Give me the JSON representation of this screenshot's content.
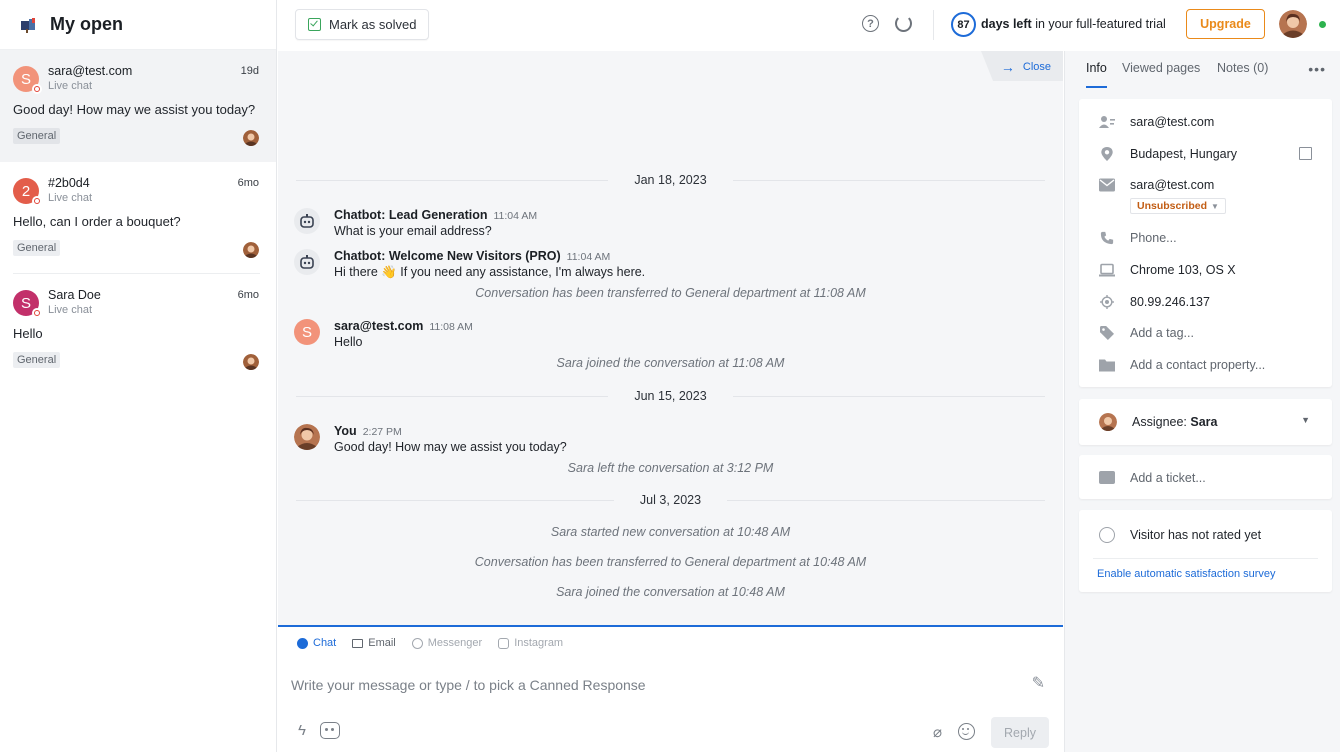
{
  "sidebar": {
    "title": "My open",
    "conversations": [
      {
        "name": "sara@test.com",
        "channel": "Live chat",
        "time": "19d",
        "message": "Good day! How may we assist you today?",
        "tag": "General",
        "avatar_letter": "S",
        "avatar_color": "#f2937a"
      },
      {
        "name": "#2b0d4",
        "channel": "Live chat",
        "time": "6mo",
        "message": "Hello, can I order a bouquet?",
        "tag": "General",
        "avatar_letter": "2",
        "avatar_color": "#e35d4a"
      },
      {
        "name": "Sara Doe",
        "channel": "Live chat",
        "time": "6mo",
        "message": "Hello",
        "tag": "General",
        "avatar_letter": "S",
        "avatar_color": "#c2306a"
      }
    ]
  },
  "toolbar": {
    "mark_solved_label": "Mark as solved",
    "help_glyph": "?",
    "trial_days": "87",
    "trial_bold": "days left",
    "trial_rest": " in your full-featured trial",
    "upgrade_label": "Upgrade"
  },
  "conversation": {
    "close_label": "Close",
    "close_glyph": "→",
    "dates": [
      "Jan 18, 2023",
      "Jun 15, 2023",
      "Jul 3, 2023"
    ],
    "messages": [
      {
        "sender": "Chatbot: Lead Generation",
        "time": "11:04 AM",
        "text": "What is your email address?"
      },
      {
        "sender": "Chatbot: Welcome New Visitors (PRO)",
        "time": "11:04 AM",
        "text": "Hi there 👋 If you need any assistance, I'm always here."
      },
      {
        "sender": "sara@test.com",
        "time": "11:08 AM",
        "text": "Hello",
        "avatar_letter": "S"
      },
      {
        "sender": "You",
        "time": "2:27 PM",
        "text": "Good day! How may we assist you today?"
      }
    ],
    "system": [
      "Conversation has been transferred to General department at 11:08 AM",
      "Sara joined the conversation at 11:08 AM",
      "Sara left the conversation at 3:12 PM",
      "Sara started new conversation at 10:48 AM",
      "Conversation has been transferred to General department at 10:48 AM",
      "Sara joined the conversation at 10:48 AM"
    ]
  },
  "composer": {
    "channels": [
      "Chat",
      "Email",
      "Messenger",
      "Instagram"
    ],
    "placeholder": "Write your message or type / to pick a Canned Response",
    "reply_label": "Reply",
    "magic_glyph": "✎",
    "bolt_glyph": "ϟ",
    "clip_glyph": "⌀"
  },
  "panel": {
    "tabs": [
      "Info",
      "Viewed pages",
      "Notes (0)"
    ],
    "more_glyph": "•••",
    "info": {
      "contact": "sara@test.com",
      "location": "Budapest, Hungary",
      "email": "sara@test.com",
      "subscription": "Unsubscribed",
      "phone": "Phone...",
      "browser": "Chrome 103, OS X",
      "ip": "80.99.246.137",
      "tag": "Add a tag...",
      "property": "Add a contact property..."
    },
    "assignee_label": "Assignee: ",
    "assignee_name": "Sara",
    "ticket": "Add a ticket...",
    "rating": "Visitor has not rated yet",
    "survey_link": "Enable automatic satisfaction survey"
  },
  "colors": {
    "accent": "#1d6bd8",
    "upgrade": "#ea8a1a",
    "online": "#2db24e"
  }
}
